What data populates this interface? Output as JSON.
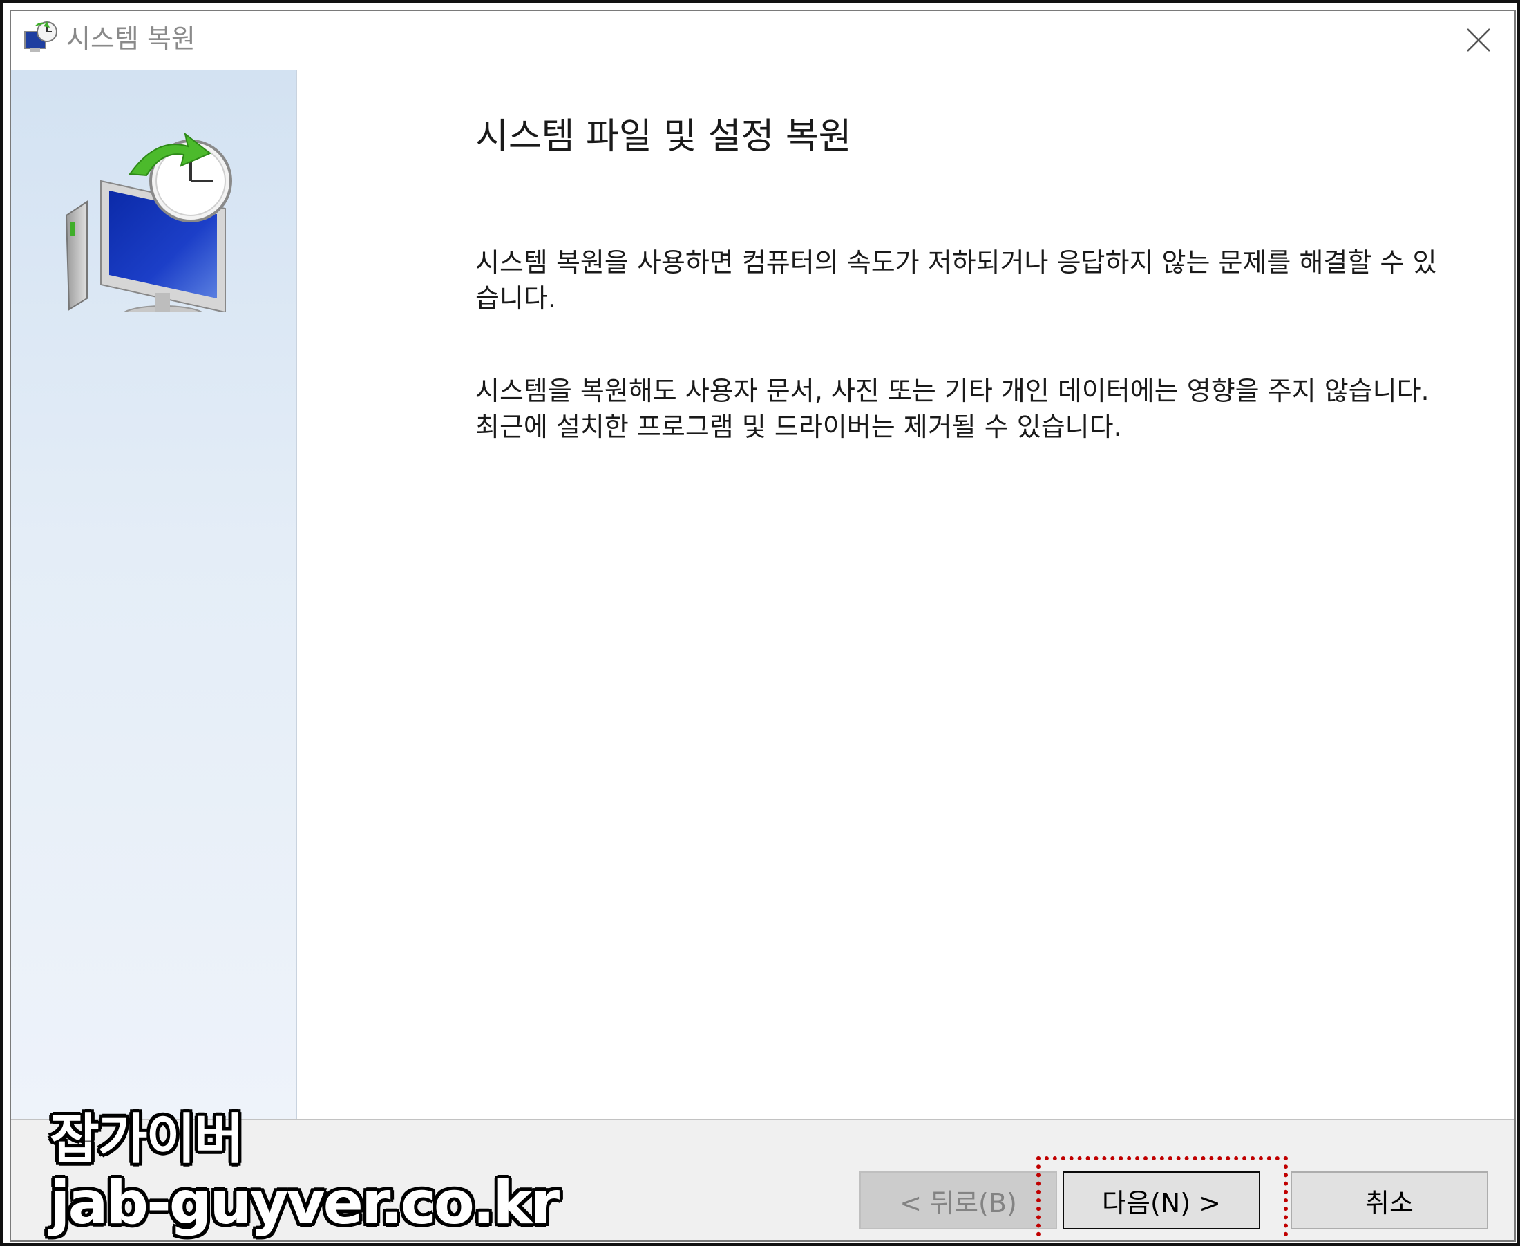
{
  "window": {
    "title": "시스템 복원",
    "icon": "system-restore-icon"
  },
  "content": {
    "heading": "시스템 파일 및 설정 복원",
    "paragraph1": "시스템 복원을 사용하면 컴퓨터의 속도가 저하되거나 응답하지 않는 문제를 해결할 수 있습니다.",
    "paragraph2": "시스템을 복원해도 사용자 문서, 사진 또는 기타 개인 데이터에는 영향을 주지 않습니다. 최근에 설치한 프로그램 및 드라이버는 제거될 수 있습니다."
  },
  "buttons": {
    "back": "< 뒤로(B)",
    "next": "다음(N) >",
    "cancel": "취소"
  },
  "watermark": {
    "line1": "잡가이버",
    "line2": "jab-guyver.co.kr"
  },
  "colors": {
    "sidebar": "#d3e2f2",
    "highlight": "#c00000",
    "footer": "#f0f0f0"
  }
}
